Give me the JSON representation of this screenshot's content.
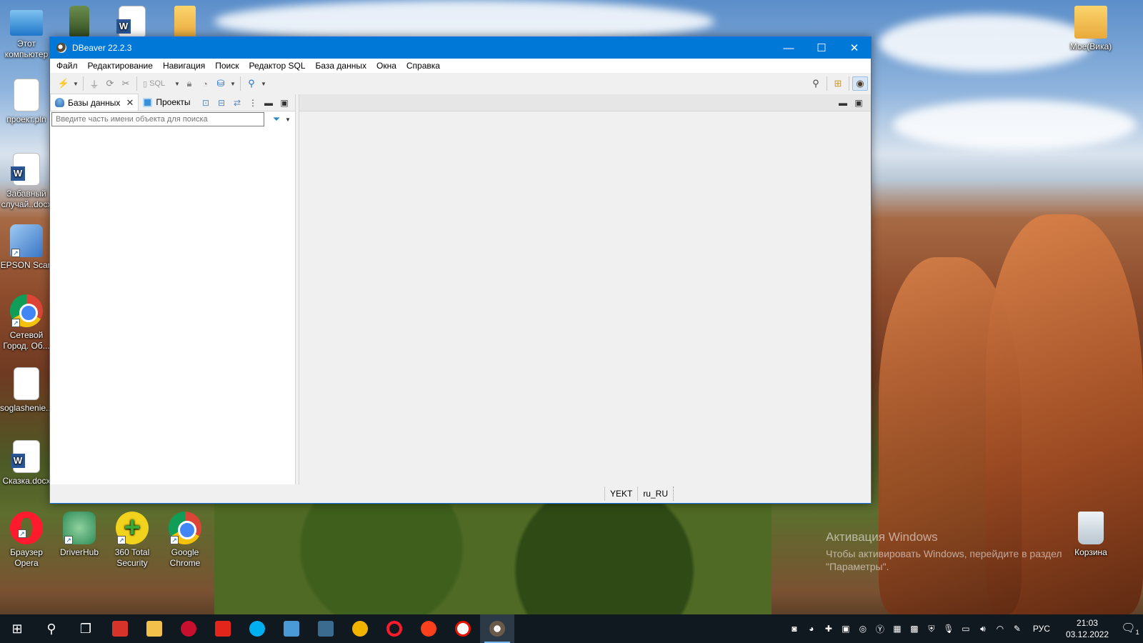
{
  "desktop": {
    "icons": [
      {
        "label": "Этот компьютер"
      },
      {
        "label": "проект.pln"
      },
      {
        "label": "Забавный случай..docx"
      },
      {
        "label": "EPSON Scan"
      },
      {
        "label": "Сетевой Город. Об..."
      },
      {
        "label": "soglashenie..."
      },
      {
        "label": "Сказка.docx"
      },
      {
        "label": "Браузер Opera"
      },
      {
        "label": "DriverHub"
      },
      {
        "label": "360 Total Security"
      },
      {
        "label": "Google Chrome"
      },
      {
        "label": "Мое(Вика)"
      },
      {
        "label": "Корзина"
      }
    ],
    "watermark": {
      "title": "Активация Windows",
      "line": "Чтобы активировать Windows, перейдите в раздел",
      "line2": "\"Параметры\"."
    }
  },
  "window": {
    "title": "DBeaver 22.2.3",
    "controls": {
      "minimize": "—",
      "maximize": "☐",
      "close": "✕"
    },
    "menu": [
      "Файл",
      "Редактирование",
      "Навигация",
      "Поиск",
      "Редактор SQL",
      "База данных",
      "Окна",
      "Справка"
    ],
    "toolbar": {
      "sql_label": "SQL"
    },
    "left_pane": {
      "tabs": [
        {
          "label": "Базы данных"
        },
        {
          "label": "Проекты"
        }
      ],
      "search_placeholder": "Введите часть имени объекта для поиска"
    },
    "status": {
      "timezone": "YEKT",
      "locale": "ru_RU"
    }
  },
  "taskbar": {
    "language": "РУС",
    "time": "21:03",
    "date": "03.12.2022",
    "notification_count": "1"
  }
}
